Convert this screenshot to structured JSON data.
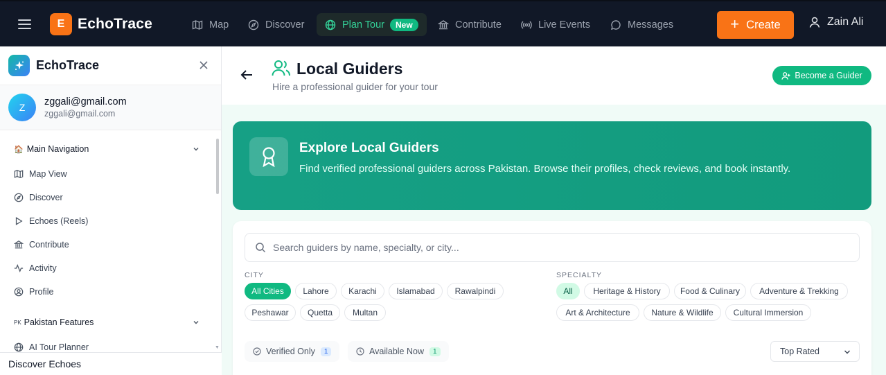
{
  "topbar": {
    "brand_letter": "E",
    "brand_name": "EchoTrace",
    "nav": [
      {
        "label": "Map",
        "icon": "map-icon"
      },
      {
        "label": "Discover",
        "icon": "compass-icon"
      },
      {
        "label": "Plan Tour",
        "icon": "globe-icon",
        "badge": "New",
        "active": true
      },
      {
        "label": "Contribute",
        "icon": "landmark-icon"
      },
      {
        "label": "Live Events",
        "icon": "broadcast-icon"
      },
      {
        "label": "Messages",
        "icon": "message-icon"
      }
    ],
    "create_label": "Create",
    "user_name": "Zain Ali"
  },
  "sidebar": {
    "title": "EchoTrace",
    "avatar_letter": "Z",
    "email": "zggali@gmail.com",
    "email_secondary": "zggali@gmail.com",
    "section_main": {
      "label": "Main Navigation",
      "emoji": "🏠"
    },
    "items": [
      {
        "label": "Map View",
        "icon": "map-icon"
      },
      {
        "label": "Discover",
        "icon": "compass-icon"
      },
      {
        "label": "Echoes (Reels)",
        "icon": "play-icon"
      },
      {
        "label": "Contribute",
        "icon": "landmark-icon"
      },
      {
        "label": "Activity",
        "icon": "activity-icon"
      },
      {
        "label": "Profile",
        "icon": "user-circle-icon"
      }
    ],
    "section_pk": {
      "label": "Pakistan Features",
      "prefix": "PK"
    },
    "pk_items": [
      {
        "label": "AI Tour Planner",
        "icon": "globe-icon"
      }
    ],
    "footer": "Discover Echoes"
  },
  "page": {
    "title": "Local Guiders",
    "subtitle": "Hire a professional guider for your tour",
    "become_label": "Become a Guider"
  },
  "hero": {
    "title": "Explore Local Guiders",
    "description": "Find verified professional guiders across Pakistan. Browse their profiles, check reviews, and book instantly."
  },
  "filters": {
    "search_placeholder": "Search guiders by name, specialty, or city...",
    "city_label": "CITY",
    "cities": [
      "All Cities",
      "Lahore",
      "Karachi",
      "Islamabad",
      "Rawalpindi",
      "Peshawar",
      "Quetta",
      "Multan"
    ],
    "city_selected": "All Cities",
    "specialty_label": "SPECIALTY",
    "specialties": [
      "All",
      "Heritage & History",
      "Food & Culinary",
      "Adventure & Trekking",
      "Art & Architecture",
      "Nature & Wildlife",
      "Cultural Immersion"
    ],
    "specialty_selected": "All",
    "verified_label": "Verified Only",
    "verified_count": "1",
    "available_label": "Available Now",
    "available_count": "1",
    "sort_value": "Top Rated"
  },
  "colors": {
    "accent": "#10b981",
    "brand_orange": "#f97316",
    "topbar_bg": "#111827",
    "hero_bg": "#16a085"
  }
}
